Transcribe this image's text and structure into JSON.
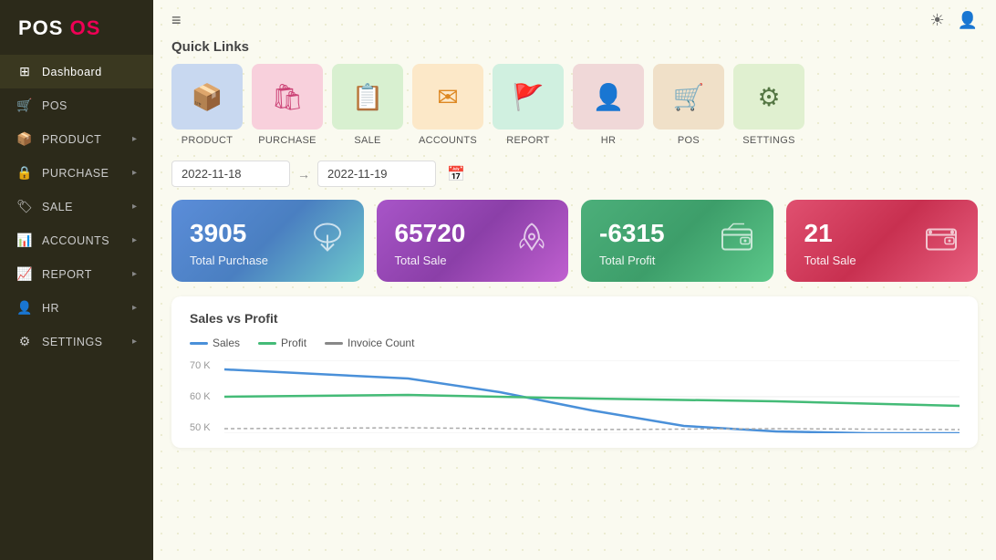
{
  "sidebar": {
    "logo_pos": "POS",
    "logo_os": " OS",
    "nav_items": [
      {
        "id": "dashboard",
        "label": "Dashboard",
        "icon": "⊞",
        "hasArrow": false,
        "active": true
      },
      {
        "id": "pos",
        "label": "POS",
        "icon": "🛒",
        "hasArrow": false
      },
      {
        "id": "product",
        "label": "PRODUCT",
        "icon": "📦",
        "hasArrow": true
      },
      {
        "id": "purchase",
        "label": "PURCHASE",
        "icon": "🔒",
        "hasArrow": true
      },
      {
        "id": "sale",
        "label": "SALE",
        "icon": "🏷",
        "hasArrow": true
      },
      {
        "id": "accounts",
        "label": "ACCOUNTS",
        "icon": "📊",
        "hasArrow": true
      },
      {
        "id": "report",
        "label": "REPORT",
        "icon": "📈",
        "hasArrow": true
      },
      {
        "id": "hr",
        "label": "HR",
        "icon": "👤",
        "hasArrow": true
      },
      {
        "id": "settings",
        "label": "SETTINGS",
        "icon": "⚙",
        "hasArrow": true
      }
    ]
  },
  "topbar": {
    "menu_icon": "≡",
    "sun_icon": "☀",
    "user_icon": "👤"
  },
  "quick_links": {
    "title": "Quick Links",
    "items": [
      {
        "id": "product",
        "label": "PRODUCT",
        "icon": "📦",
        "bg": "#c8d8f0",
        "icon_color": "#5588cc"
      },
      {
        "id": "purchase",
        "label": "PURCHASE",
        "icon": "🛍",
        "bg": "#f8d0dc",
        "icon_color": "#cc4477"
      },
      {
        "id": "sale",
        "label": "SALE",
        "icon": "📋",
        "bg": "#d8f0d0",
        "icon_color": "#55aa44"
      },
      {
        "id": "accounts",
        "label": "ACCOUNTS",
        "icon": "✉",
        "bg": "#fce8c8",
        "icon_color": "#dd8822"
      },
      {
        "id": "report",
        "label": "REPORT",
        "icon": "🚩",
        "bg": "#d0f0e0",
        "icon_color": "#33aa77"
      },
      {
        "id": "hr",
        "label": "HR",
        "icon": "👤",
        "bg": "#f0d8d8",
        "icon_color": "#cc4444"
      },
      {
        "id": "pos",
        "label": "POS",
        "icon": "🛒",
        "bg": "#f0e0c8",
        "icon_color": "#aa6622"
      },
      {
        "id": "settings",
        "label": "SETTINGS",
        "icon": "⚙",
        "bg": "#e0f0d0",
        "icon_color": "#557744"
      }
    ]
  },
  "date_filter": {
    "start": "2022-11-18",
    "end": "2022-11-19",
    "arrow": "→",
    "calendar_icon": "📅"
  },
  "stat_cards": [
    {
      "id": "total-purchase",
      "value": "3905",
      "label": "Total Purchase",
      "icon_type": "download-cloud"
    },
    {
      "id": "total-sale",
      "value": "65720",
      "label": "Total Sale",
      "icon_type": "rocket"
    },
    {
      "id": "total-profit",
      "value": "-6315",
      "label": "Total Profit",
      "icon_type": "wallet"
    },
    {
      "id": "total-sale-2",
      "value": "21",
      "label": "Total Sale",
      "icon_type": "wallet2"
    }
  ],
  "chart": {
    "title": "Sales vs Profit",
    "legend": [
      {
        "label": "Sales",
        "color": "#4a90d9"
      },
      {
        "label": "Profit",
        "color": "#44bb77"
      },
      {
        "label": "Invoice Count",
        "color": "#888"
      }
    ],
    "y_labels": [
      "70 K",
      "60 K",
      "50 K"
    ]
  }
}
